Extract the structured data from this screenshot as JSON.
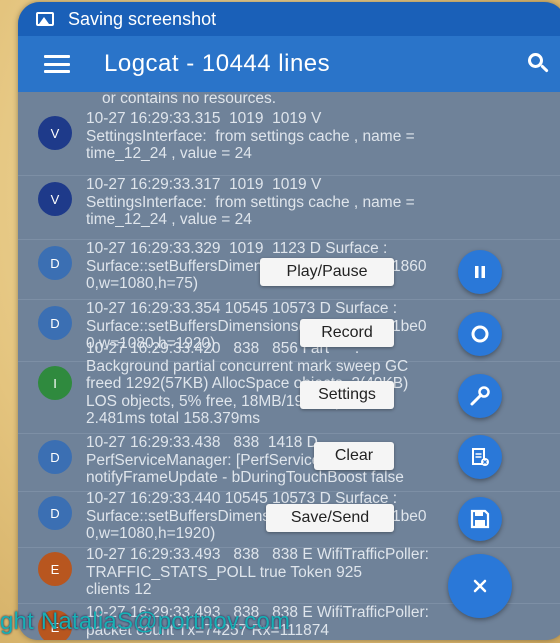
{
  "status_bar": {
    "text": "Saving screenshot",
    "icon": "image-icon"
  },
  "app_bar": {
    "title": "Logcat - 10444 lines",
    "menu_icon": "hamburger-menu-icon",
    "search_icon": "search-icon"
  },
  "log": {
    "partial_top": "or contains no resources.",
    "rows": [
      {
        "level": "V",
        "text": "10-27 16:29:33.315  1019  1019 V\nSettingsInterface:  from settings cache , name =\ntime_12_24 , value = 24"
      },
      {
        "level": "V",
        "text": "10-27 16:29:33.317  1019  1019 V\nSettingsInterface:  from settings cache , name =\ntime_12_24 , value = 24"
      },
      {
        "level": "D",
        "text": "10-27 16:29:33.329  1019  1123 D Surface :\nSurface::setBuffersDimensions(this=0x7f93e1860\n0,w=1080,h=75)"
      },
      {
        "level": "D",
        "text": "10-27 16:29:33.354 10545 10573 D Surface :\nSurface::setBuffersDimensions(this=0x7f93e1be0\n0,w=1080,h=1920)"
      },
      {
        "level": "I",
        "text": "10-27 16:29:33.420   838   856 I art      :\nBackground partial concurrent mark sweep GC\nfreed 1292(57KB) AllocSpace objects, 2(40KB)\nLOS objects, 5% free, 18MB/19MB, paused\n2.481ms total 158.379ms"
      },
      {
        "level": "D",
        "text": "10-27 16:29:33.438   838  1418 D\nPerfServiceManager: [PerfService]\nnotifyFrameUpdate - bDuringTouchBoost false"
      },
      {
        "level": "D",
        "text": "10-27 16:29:33.440 10545 10573 D Surface :\nSurface::setBuffersDimensions(this=0x7f93e1be0\n0,w=1080,h=1920)"
      },
      {
        "level": "E",
        "text": "10-27 16:29:33.493   838   838 E WifiTrafficPoller:\nTRAFFIC_STATS_POLL true Token 925\nclients 12"
      },
      {
        "level": "E",
        "text": "10-27 16:29:33.493   838   838 E WifiTrafficPoller:\npacket count Tx=74257 Rx=111874"
      }
    ]
  },
  "fab_menu": {
    "items": [
      {
        "label": "Play/Pause",
        "icon": "pause-icon"
      },
      {
        "label": "Record",
        "icon": "record-icon"
      },
      {
        "label": "Settings",
        "icon": "wrench-icon"
      },
      {
        "label": "Clear",
        "icon": "clear-icon"
      },
      {
        "label": "Save/Send",
        "icon": "save-icon"
      }
    ],
    "close_icon": "close-icon"
  },
  "watermark": "ght NataliaS@portnov.com",
  "colors": {
    "status_bar": "#1a60b8",
    "app_bar": "#2a74c9",
    "fab": "#2a78d8",
    "verbose": "#1e3a8a",
    "debug": "#3b6fb3",
    "info": "#2f8a3e",
    "error": "#b8561f"
  }
}
